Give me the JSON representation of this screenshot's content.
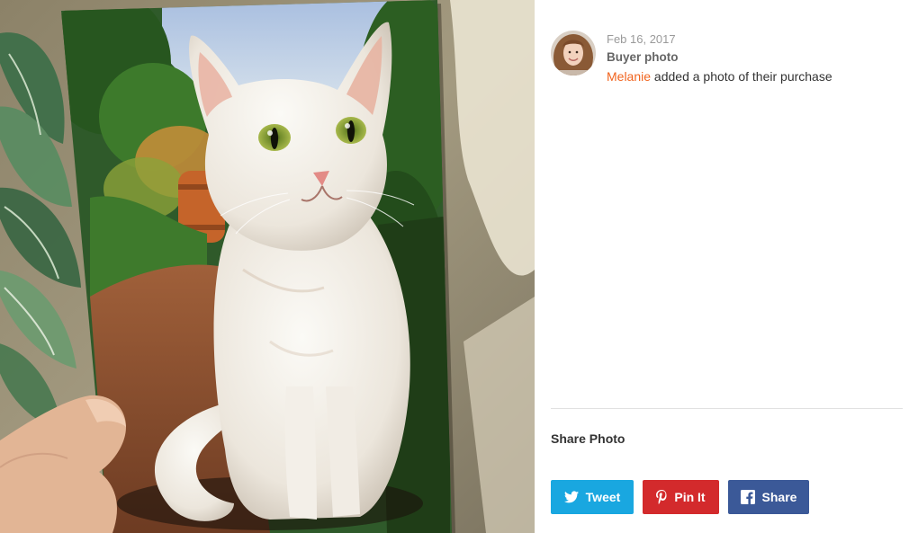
{
  "post": {
    "date": "Feb 16, 2017",
    "kind": "Buyer photo",
    "username": "Melanie",
    "action_text": "added a photo of their purchase"
  },
  "share": {
    "title": "Share Photo",
    "tweet_label": "Tweet",
    "pin_label": "Pin It",
    "facebook_label": "Share"
  },
  "colors": {
    "username": "#f1641e",
    "tweet": "#19a7e0",
    "pin": "#d32a2c",
    "facebook": "#3b5998"
  },
  "icons": [
    "twitter-bird-icon",
    "pinterest-p-icon",
    "facebook-f-icon"
  ]
}
